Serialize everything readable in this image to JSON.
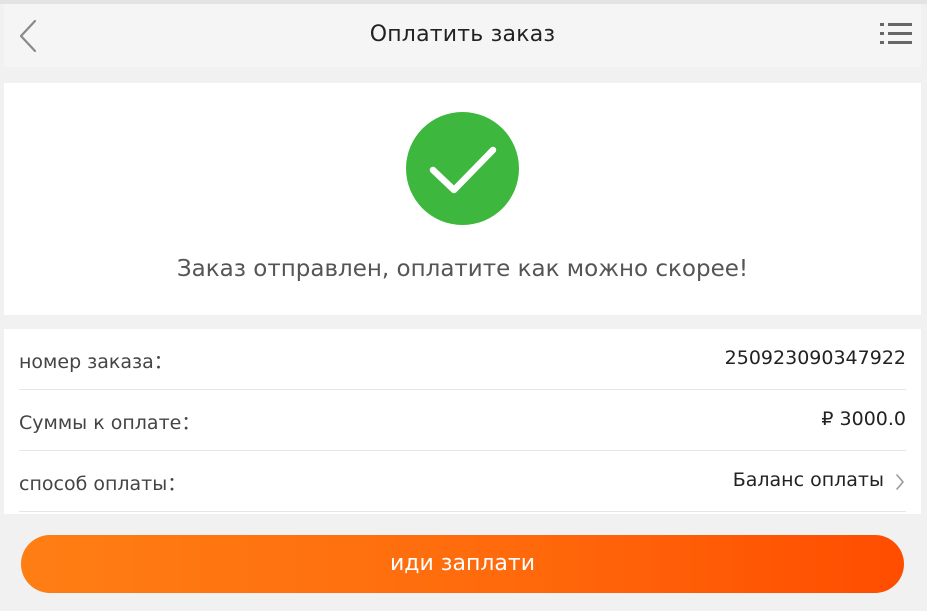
{
  "header": {
    "title": "Оплатить заказ",
    "back_icon": "chevron-left-icon",
    "menu_icon": "list-menu-icon"
  },
  "success": {
    "icon": "checkmark-circle-icon",
    "icon_color": "#3db73d",
    "message": "Заказ отправлен, оплатите как можно скорее!"
  },
  "details": {
    "order_number_label": "номер заказа：",
    "order_number_value": "250923090347922",
    "amount_label": "Суммы к оплате：",
    "amount_value": "₽ 3000.0",
    "payment_method_label": "способ оплаты：",
    "payment_method_value": "Баланс оплаты",
    "payment_method_icon": "chevron-right-icon"
  },
  "actions": {
    "pay_label": "иди заплати",
    "pay_color_start": "#ff7e14",
    "pay_color_end": "#ff4d00"
  }
}
